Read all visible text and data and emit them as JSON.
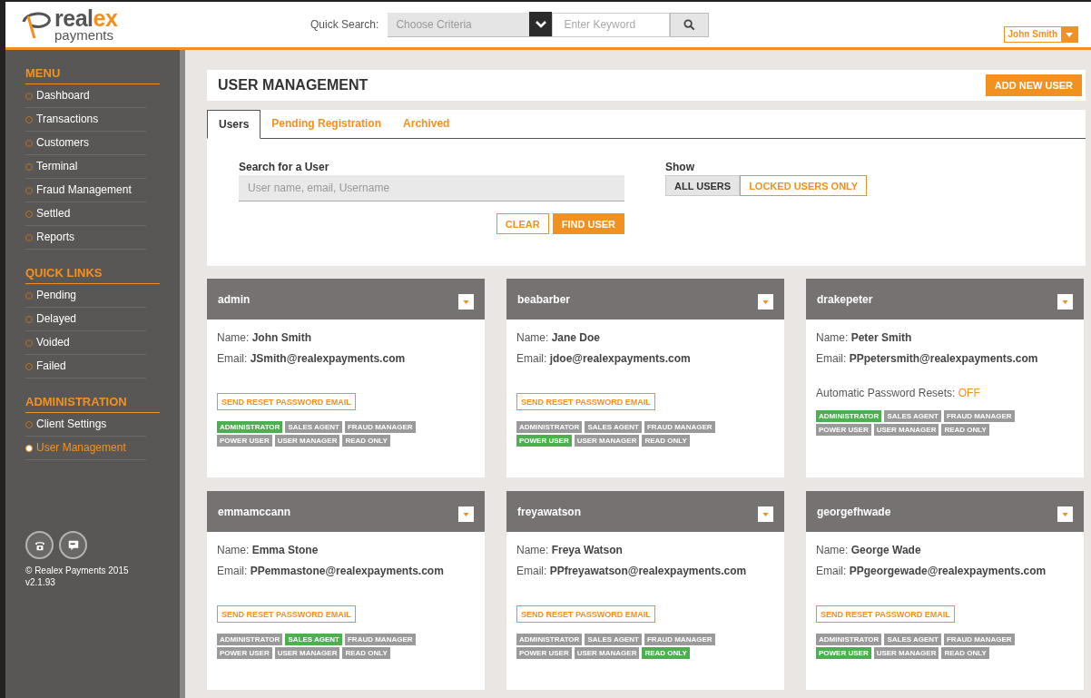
{
  "header": {
    "logo": {
      "part_1": "real",
      "part_2": "ex",
      "subtitle": "payments"
    },
    "quick_search": {
      "label": "Quick Search:",
      "criteria_placeholder": "Choose Criteria",
      "keyword_placeholder": "Enter Keyword"
    },
    "user_menu": "John Smith"
  },
  "sidebar": {
    "sections": [
      {
        "title": "MENU",
        "items": [
          {
            "label": "Dashboard",
            "selected": false
          },
          {
            "label": "Transactions",
            "selected": false
          },
          {
            "label": "Customers",
            "selected": false
          },
          {
            "label": "Terminal",
            "selected": false
          },
          {
            "label": "Fraud Management",
            "selected": false
          },
          {
            "label": "Settled",
            "selected": false
          },
          {
            "label": "Reports",
            "selected": false
          }
        ]
      },
      {
        "title": "QUICK LINKS",
        "items": [
          {
            "label": "Pending",
            "selected": false
          },
          {
            "label": "Delayed",
            "selected": false
          },
          {
            "label": "Voided",
            "selected": false
          },
          {
            "label": "Failed",
            "selected": false
          }
        ]
      },
      {
        "title": "ADMINISTRATION",
        "items": [
          {
            "label": "Client Settings",
            "selected": false
          },
          {
            "label": "User Management",
            "selected": true
          }
        ]
      }
    ],
    "copyright": "© Realex Payments 2015",
    "version": "v2.1.93"
  },
  "page": {
    "title": "USER MANAGEMENT",
    "add_button": "ADD NEW USER",
    "tabs": [
      {
        "label": "Users",
        "selected": true
      },
      {
        "label": "Pending Registration",
        "selected": false
      },
      {
        "label": "Archived",
        "selected": false
      }
    ],
    "search": {
      "label": "Search for a User",
      "placeholder": "User name, email, Username",
      "clear_button": "CLEAR",
      "find_button": "FIND USER"
    },
    "show": {
      "label": "Show",
      "options": [
        {
          "label": "ALL USERS",
          "selected": true
        },
        {
          "label": "LOCKED USERS ONLY",
          "selected": false
        }
      ]
    }
  },
  "users": [
    {
      "username": "admin",
      "name_label": "Name:",
      "name": "John Smith",
      "email_label": "Email:",
      "email": "JSmith@realexpayments.com",
      "kind": "reset_button",
      "reset_button": "SEND RESET PASSWORD EMAIL",
      "roles": [
        {
          "label": "ADMINISTRATOR",
          "on": true
        },
        {
          "label": "SALES AGENT",
          "on": false
        },
        {
          "label": "FRAUD MANAGER",
          "on": false
        },
        {
          "label": "POWER USER",
          "on": false
        },
        {
          "label": "USER MANAGER",
          "on": false
        },
        {
          "label": "READ ONLY",
          "on": false
        }
      ]
    },
    {
      "username": "beabarber",
      "name_label": "Name:",
      "name": "Jane Doe",
      "email_label": "Email:",
      "email": "jdoe@realexpayments.com",
      "kind": "reset_button",
      "reset_button": "SEND RESET PASSWORD EMAIL",
      "roles": [
        {
          "label": "ADMINISTRATOR",
          "on": false
        },
        {
          "label": "SALES AGENT",
          "on": false
        },
        {
          "label": "FRAUD MANAGER",
          "on": false
        },
        {
          "label": "POWER USER",
          "on": true
        },
        {
          "label": "USER MANAGER",
          "on": false
        },
        {
          "label": "READ ONLY",
          "on": false
        }
      ]
    },
    {
      "username": "drakepeter",
      "name_label": "Name:",
      "name": "Peter Smith",
      "email_label": "Email:",
      "email": "PPpetersmith@realexpayments.com",
      "kind": "auto_reset",
      "auto_reset_label": "Automatic Password Resets:",
      "auto_reset_value": "OFF",
      "roles": [
        {
          "label": "ADMINISTRATOR",
          "on": true
        },
        {
          "label": "SALES AGENT",
          "on": false
        },
        {
          "label": "FRAUD MANAGER",
          "on": false
        },
        {
          "label": "POWER USER",
          "on": false
        },
        {
          "label": "USER MANAGER",
          "on": false
        },
        {
          "label": "READ ONLY",
          "on": false
        }
      ]
    },
    {
      "username": "emmamccann",
      "name_label": "Name:",
      "name": "Emma Stone",
      "email_label": "Email:",
      "email": "PPemmastone@realexpayments.com",
      "kind": "reset_button",
      "reset_button": "SEND RESET PASSWORD EMAIL",
      "roles": [
        {
          "label": "ADMINISTRATOR",
          "on": false
        },
        {
          "label": "SALES AGENT",
          "on": true
        },
        {
          "label": "FRAUD MANAGER",
          "on": false
        },
        {
          "label": "POWER USER",
          "on": false
        },
        {
          "label": "USER MANAGER",
          "on": false
        },
        {
          "label": "READ ONLY",
          "on": false
        }
      ]
    },
    {
      "username": "freyawatson",
      "name_label": "Name:",
      "name": "Freya Watson",
      "email_label": "Email:",
      "email": "PPfreyawatson@realexpayments.com",
      "kind": "reset_button",
      "reset_button": "SEND RESET PASSWORD EMAIL",
      "roles": [
        {
          "label": "ADMINISTRATOR",
          "on": false
        },
        {
          "label": "SALES AGENT",
          "on": false
        },
        {
          "label": "FRAUD MANAGER",
          "on": false
        },
        {
          "label": "POWER USER",
          "on": false
        },
        {
          "label": "USER MANAGER",
          "on": false
        },
        {
          "label": "READ ONLY",
          "on": true
        }
      ]
    },
    {
      "username": "georgefhwade",
      "name_label": "Name:",
      "name": "George Wade",
      "email_label": "Email:",
      "email": "PPgeorgewade@realexpayments.com",
      "kind": "reset_button",
      "reset_button": "SEND RESET PASSWORD EMAIL",
      "roles": [
        {
          "label": "ADMINISTRATOR",
          "on": false
        },
        {
          "label": "SALES AGENT",
          "on": false
        },
        {
          "label": "FRAUD MANAGER",
          "on": false
        },
        {
          "label": "POWER USER",
          "on": true
        },
        {
          "label": "USER MANAGER",
          "on": false
        },
        {
          "label": "READ ONLY",
          "on": false
        }
      ]
    }
  ]
}
